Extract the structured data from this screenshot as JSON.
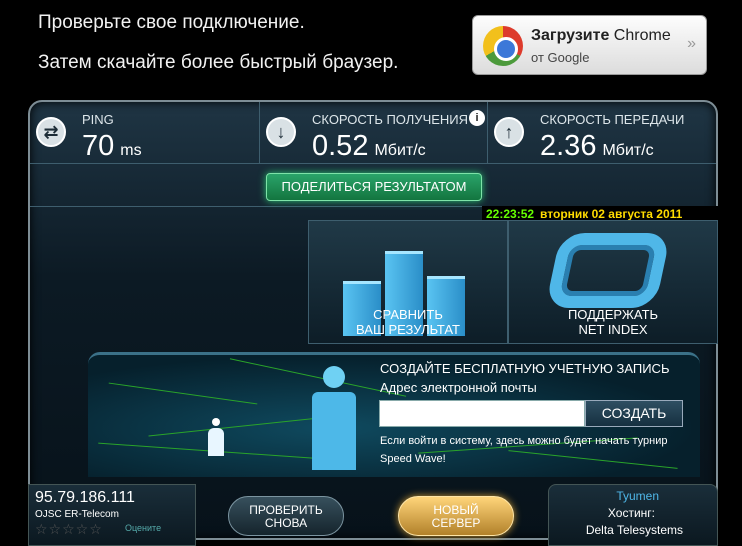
{
  "promo": {
    "line1": "Проверьте свое подключение.",
    "line2": "Затем скачайте более быстрый браузер.",
    "chrome": {
      "title_bold": "Загрузите",
      "title_rest": " Chrome",
      "subtitle": "от Google",
      "arrow": "»"
    }
  },
  "stats": {
    "ping": {
      "label": "PING",
      "value": "70",
      "unit": "ms",
      "icon": "transfer-arrows-icon"
    },
    "download": {
      "label": "СКОРОСТЬ ПОЛУЧЕНИЯ",
      "value": "0.52",
      "unit": "Мбит/с",
      "icon": "download-arrow-icon",
      "info": "i"
    },
    "upload": {
      "label": "СКОРОСТЬ ПЕРЕДАЧИ",
      "value": "2.36",
      "unit": "Мбит/с",
      "icon": "upload-arrow-icon"
    }
  },
  "share_label": "ПОДЕЛИТЬСЯ РЕЗУЛЬТАТОМ",
  "datetime": {
    "time": "22:23:52",
    "date": "вторник 02 августа 2011"
  },
  "tiles": {
    "compare": {
      "line1": "СРАВНИТЬ",
      "line2": "ВАШ РЕЗУЛЬТАТ"
    },
    "support": {
      "line1": "ПОДДЕРЖАТЬ",
      "line2": "NET INDEX"
    }
  },
  "signup": {
    "title": "СОЗДАЙТЕ БЕСПЛАТНУЮ УЧЕТНУЮ ЗАПИСЬ",
    "email_label": "Адрес электронной почты",
    "email_value": "",
    "create_label": "СОЗДАТЬ",
    "note": "Если войти в систему, здесь можно будет начать турнир Speed Wave!"
  },
  "footer": {
    "ip": "95.79.186.111",
    "isp": "OJSC ER-Telecom",
    "stars": "☆☆☆☆☆",
    "rate": "Оцените",
    "retest_line1": "ПРОВЕРИТЬ",
    "retest_line2": "СНОВА",
    "new_server_line1": "НОВЫЙ",
    "new_server_line2": "СЕРВЕР",
    "server_city": "Tyumen",
    "host_label": "Хостинг:",
    "host_name": "Delta Telesystems"
  },
  "colors": {
    "time": "#66ff00",
    "date": "#ffdc00",
    "accent": "#4fb7e8",
    "share_green": "#2aa46a"
  }
}
